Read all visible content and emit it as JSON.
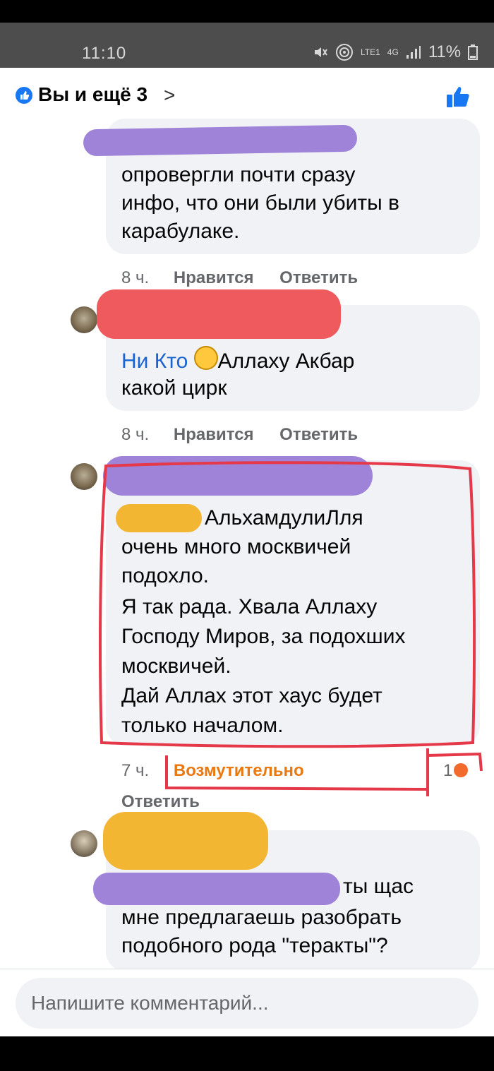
{
  "status_bar": {
    "time": "11:10",
    "lte_label": "LTE1",
    "network": "4G",
    "battery": "11%"
  },
  "header": {
    "title": "Вы и ещё 3",
    "chevron": ">",
    "like_icon": "thumbs-up-icon"
  },
  "comments": [
    {
      "lines": [
        "опровергли почти сразу",
        "инфо, что они были убиты в",
        "карабулаке."
      ],
      "time": "8 ч.",
      "like_label": "Нравится",
      "reply_label": "Ответить"
    },
    {
      "mention": "Ни Кто",
      "line1_rest": "Аллаху Акбар",
      "lines": [
        "какой цирк"
      ],
      "time": "8 ч.",
      "like_label": "Нравится",
      "reply_label": "Ответить"
    },
    {
      "line1_rest": "АльхамдулиЛля",
      "lines": [
        "очень много  москвичей",
        "подохло.",
        "Я так рада. Хвала  Аллаху",
        "Господу Миров, за подохших",
        "москвичей.",
        "Дай Аллах  этот хаус будет",
        "только началом."
      ],
      "time": "7 ч.",
      "reaction_label": "Возмутительно",
      "reaction_count": "1",
      "reply_label": "Ответить"
    },
    {
      "line1_rest": "ты щас",
      "lines": [
        "мне предлагаешь разобрать",
        "подобного рода \"теракты\"?"
      ]
    }
  ],
  "composer": {
    "placeholder": "Напишите комментарий..."
  },
  "colors": {
    "accent_blue": "#1877f2",
    "angry_orange": "#e97910",
    "highlight_red": "#e5394a",
    "redact_purple": "#9f83d8",
    "redact_red": "#ee5a5e",
    "redact_yellow": "#f2b632"
  }
}
